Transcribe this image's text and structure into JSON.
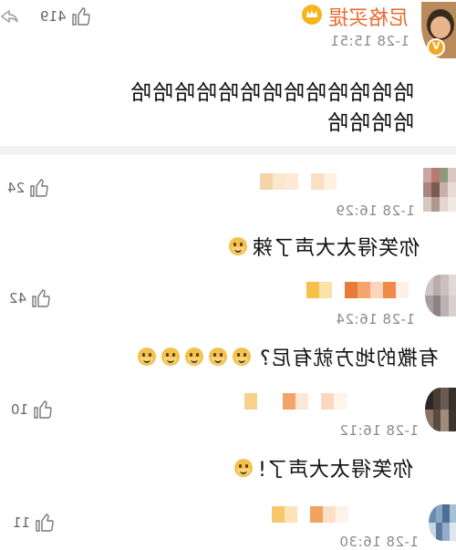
{
  "top_post": {
    "author": "尼格买提",
    "time": "1-28 15:51",
    "like_count": "419",
    "text_line1": "哈哈哈哈哈哈哈哈哈哈哈哈哈",
    "text_line2": "哈哈哈哈"
  },
  "comments": [
    {
      "time": "1-28 16:29",
      "like_count": "24",
      "text": "你笑得太大声了辣"
    },
    {
      "time": "1-28 16:24",
      "like_count": "42",
      "text": "有撒的地方就有尼?"
    },
    {
      "time": "1-28 16:12",
      "like_count": "10",
      "text": "你笑得太大声了!"
    },
    {
      "time": "1-28 16:30",
      "like_count": "11",
      "text": ""
    }
  ],
  "icons": {
    "like": "thumbs-up-icon",
    "emoji": "doge-emoji-icon",
    "badge": "verified-badge-icon"
  },
  "colors": {
    "author_name": "#e86a2f",
    "timestamp": "#8a8a8a",
    "divider": "#f2f2f2"
  }
}
